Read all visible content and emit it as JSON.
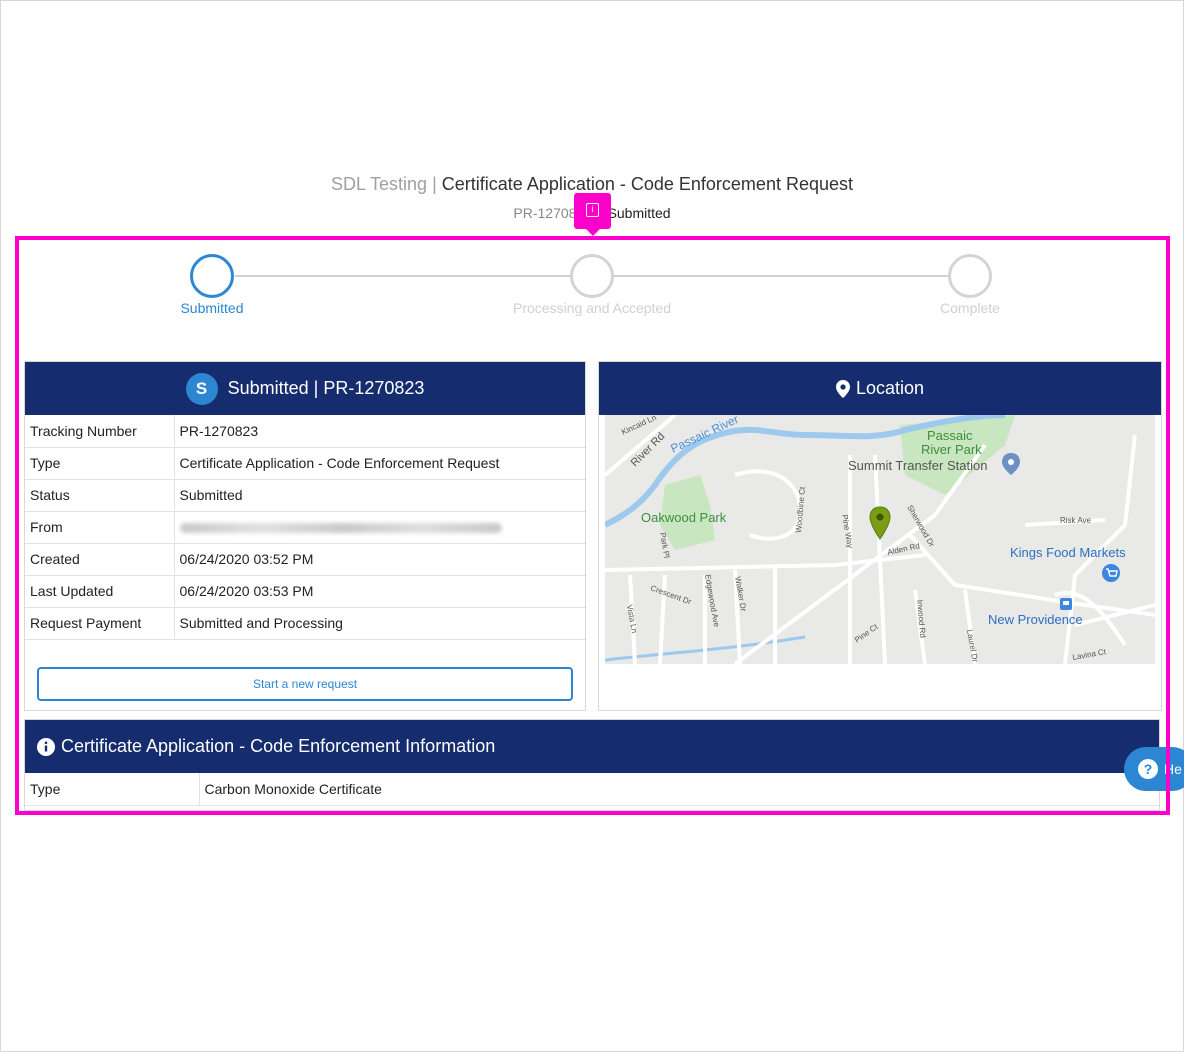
{
  "header": {
    "org": "SDL Testing",
    "separator": "|",
    "title": "Certificate Application - Code Enforcement Request",
    "request_number": "PR-12708",
    "status": "Submitted"
  },
  "steps": [
    {
      "label": "Submitted",
      "active": true
    },
    {
      "label": "Processing and Accepted",
      "active": false
    },
    {
      "label": "Complete",
      "active": false
    }
  ],
  "summary": {
    "badge": "S",
    "heading": "Submitted | PR-1270823",
    "rows": [
      {
        "label": "Tracking Number",
        "value": "PR-1270823"
      },
      {
        "label": "Type",
        "value": "Certificate Application - Code Enforcement Request"
      },
      {
        "label": "Status",
        "value": "Submitted"
      },
      {
        "label": "From",
        "value": ""
      },
      {
        "label": "Created",
        "value": "06/24/2020 03:52 PM"
      },
      {
        "label": "Last Updated",
        "value": "06/24/2020 03:53 PM"
      },
      {
        "label": "Request Payment",
        "value": "Submitted and Processing"
      }
    ],
    "new_request_label": "Start a new request"
  },
  "location": {
    "heading": "Location",
    "map_labels": {
      "passaic_river": "Passaic River",
      "passaic_river_park_1": "Passaic",
      "passaic_river_park_2": "River Park",
      "summit_transfer": "Summit Transfer Station",
      "oakwood_park": "Oakwood Park",
      "kings_food": "Kings Food Markets",
      "new_providence": "New Providence",
      "kincaid": "Kincaid Ln",
      "river_rd": "River Rd",
      "woodbine": "Woodbine Ct",
      "pine_way": "Pine Way",
      "sherwood": "Sherwood Dr",
      "alden": "Alden Rd",
      "risk_ave": "Risk Ave",
      "park_pl": "Park Pl",
      "crescent": "Crescent Dr",
      "edgewood": "Edgewood Ave",
      "walker": "Walker Dr",
      "vista": "Vista Ln",
      "inwood": "Inwood Rd",
      "laurel": "Laurel Dr",
      "pine_ct": "Pine Ct",
      "lavina": "Lavina Ct"
    }
  },
  "details": {
    "heading": "Certificate Application - Code Enforcement Information",
    "rows": [
      {
        "label": "Type",
        "value": "Carbon Monoxide Certificate"
      }
    ]
  },
  "help": {
    "label": "He"
  },
  "colors": {
    "header_navy": "#152d6e",
    "accent_blue": "#2c86d1",
    "highlight_magenta": "#ff00cc"
  }
}
